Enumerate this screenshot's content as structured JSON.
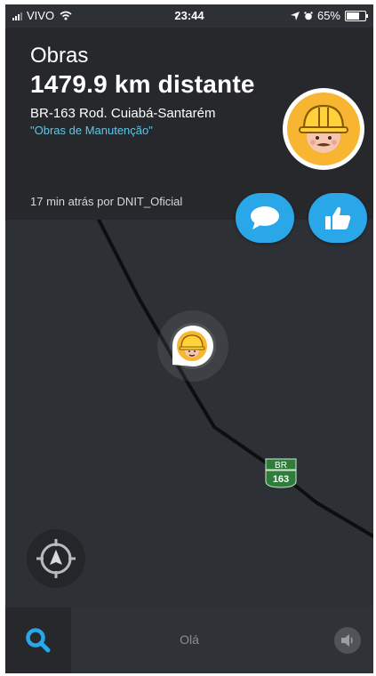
{
  "status": {
    "carrier": "VIVO",
    "time": "23:44",
    "battery": "65%"
  },
  "alert": {
    "title": "Obras",
    "distance": "1479.9 km distante",
    "road": "BR-163 Rod. Cuiabá-Santarém",
    "description": "\"Obras de Manutenção\"",
    "meta": "17 min atrás por DNIT_Oficial"
  },
  "map": {
    "shield_top": "BR",
    "shield_number": "163"
  },
  "bottom": {
    "greeting": "Olá"
  },
  "colors": {
    "accent_blue": "#2aa7e8",
    "link_blue": "#5fc7e8",
    "map_bg": "#2d3035",
    "card_bg": "#26282c",
    "hazard_yellow": "#f7b531",
    "road_black": "#0d0e10",
    "shield_green": "#2e7d3a"
  },
  "icons": {
    "wifi": "wifi-icon",
    "location": "location-arrow-icon",
    "alarm": "alarm-icon",
    "comment": "comment-icon",
    "like": "thumbs-up-icon",
    "search": "search-icon",
    "sound": "speaker-icon",
    "compass": "recenter-icon",
    "worker": "construction-worker-icon"
  }
}
